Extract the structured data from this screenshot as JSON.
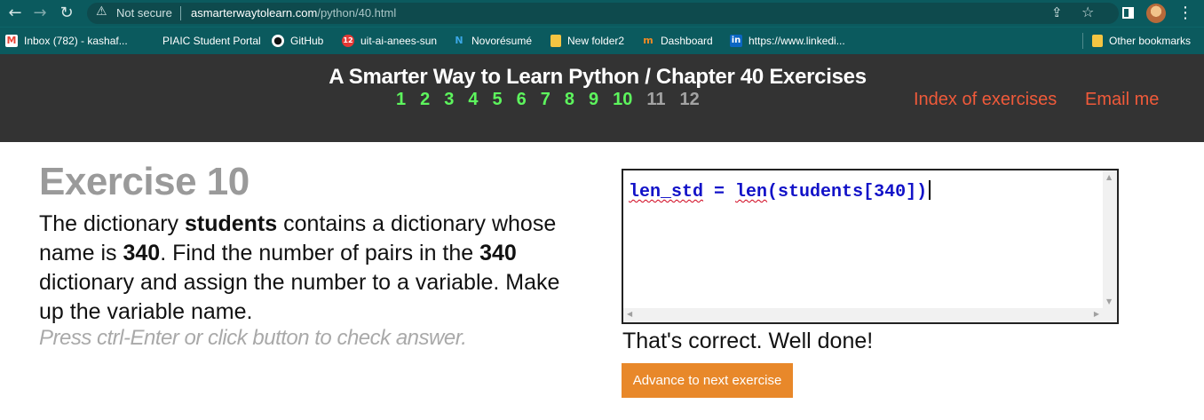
{
  "browser": {
    "security_label": "Not secure",
    "url_host": "asmarterwaytolearn.com",
    "url_path": "/python/40.html"
  },
  "bookmarks": [
    {
      "label": "Inbox (782) - kashaf...",
      "icon": "gmail-icon",
      "color": "#ea4335"
    },
    {
      "label": "PIAIC Student Portal",
      "icon": "blank-page-icon",
      "color": "#0b5a5e"
    },
    {
      "label": "GitHub",
      "icon": "github-icon",
      "color": "#ffffff"
    },
    {
      "label": "uit-ai-anees-sun",
      "icon": "badge-12-icon",
      "color": "#e53935"
    },
    {
      "label": "Novorésumé",
      "icon": "novoresume-icon",
      "color": "#3b82c4"
    },
    {
      "label": "New folder2",
      "icon": "folder-icon",
      "color": "#f4c542"
    },
    {
      "label": "Dashboard",
      "icon": "dashboard-icon",
      "color": "#f08a24"
    },
    {
      "label": "https://www.linkedi...",
      "icon": "linkedin-icon",
      "color": "#0a66c2"
    },
    {
      "label": "Other bookmarks",
      "icon": "folder-icon",
      "color": "#f4c542"
    }
  ],
  "site": {
    "title": "A Smarter Way to Learn Python / Chapter 40 Exercises",
    "exercise_numbers": [
      "1",
      "2",
      "3",
      "4",
      "5",
      "6",
      "7",
      "8",
      "9",
      "10",
      "11",
      "12"
    ],
    "index_link": "Index of exercises",
    "email_link": "Email me",
    "active_color": "#5df55d",
    "link_color": "#f05a3a"
  },
  "exercise": {
    "title": "Exercise 10",
    "text_1": "The dictionary ",
    "bold_1": "students",
    "text_2": " contains a dictionary whose name is ",
    "bold_2": "340",
    "text_3": ". Find the number of pairs in the ",
    "bold_3": "340",
    "text_4": " dictionary and assign the number to a variable. Make up the variable name.",
    "hint": "Press ctrl-Enter or click button to check answer."
  },
  "editor": {
    "code_var": "len_std",
    "code_rest": " = ",
    "code_func": "len",
    "code_args": "(students[340])"
  },
  "result": {
    "message": "That's correct. Well done!",
    "advance_label": "Advance to next exercise",
    "button_color": "#e8882a"
  }
}
